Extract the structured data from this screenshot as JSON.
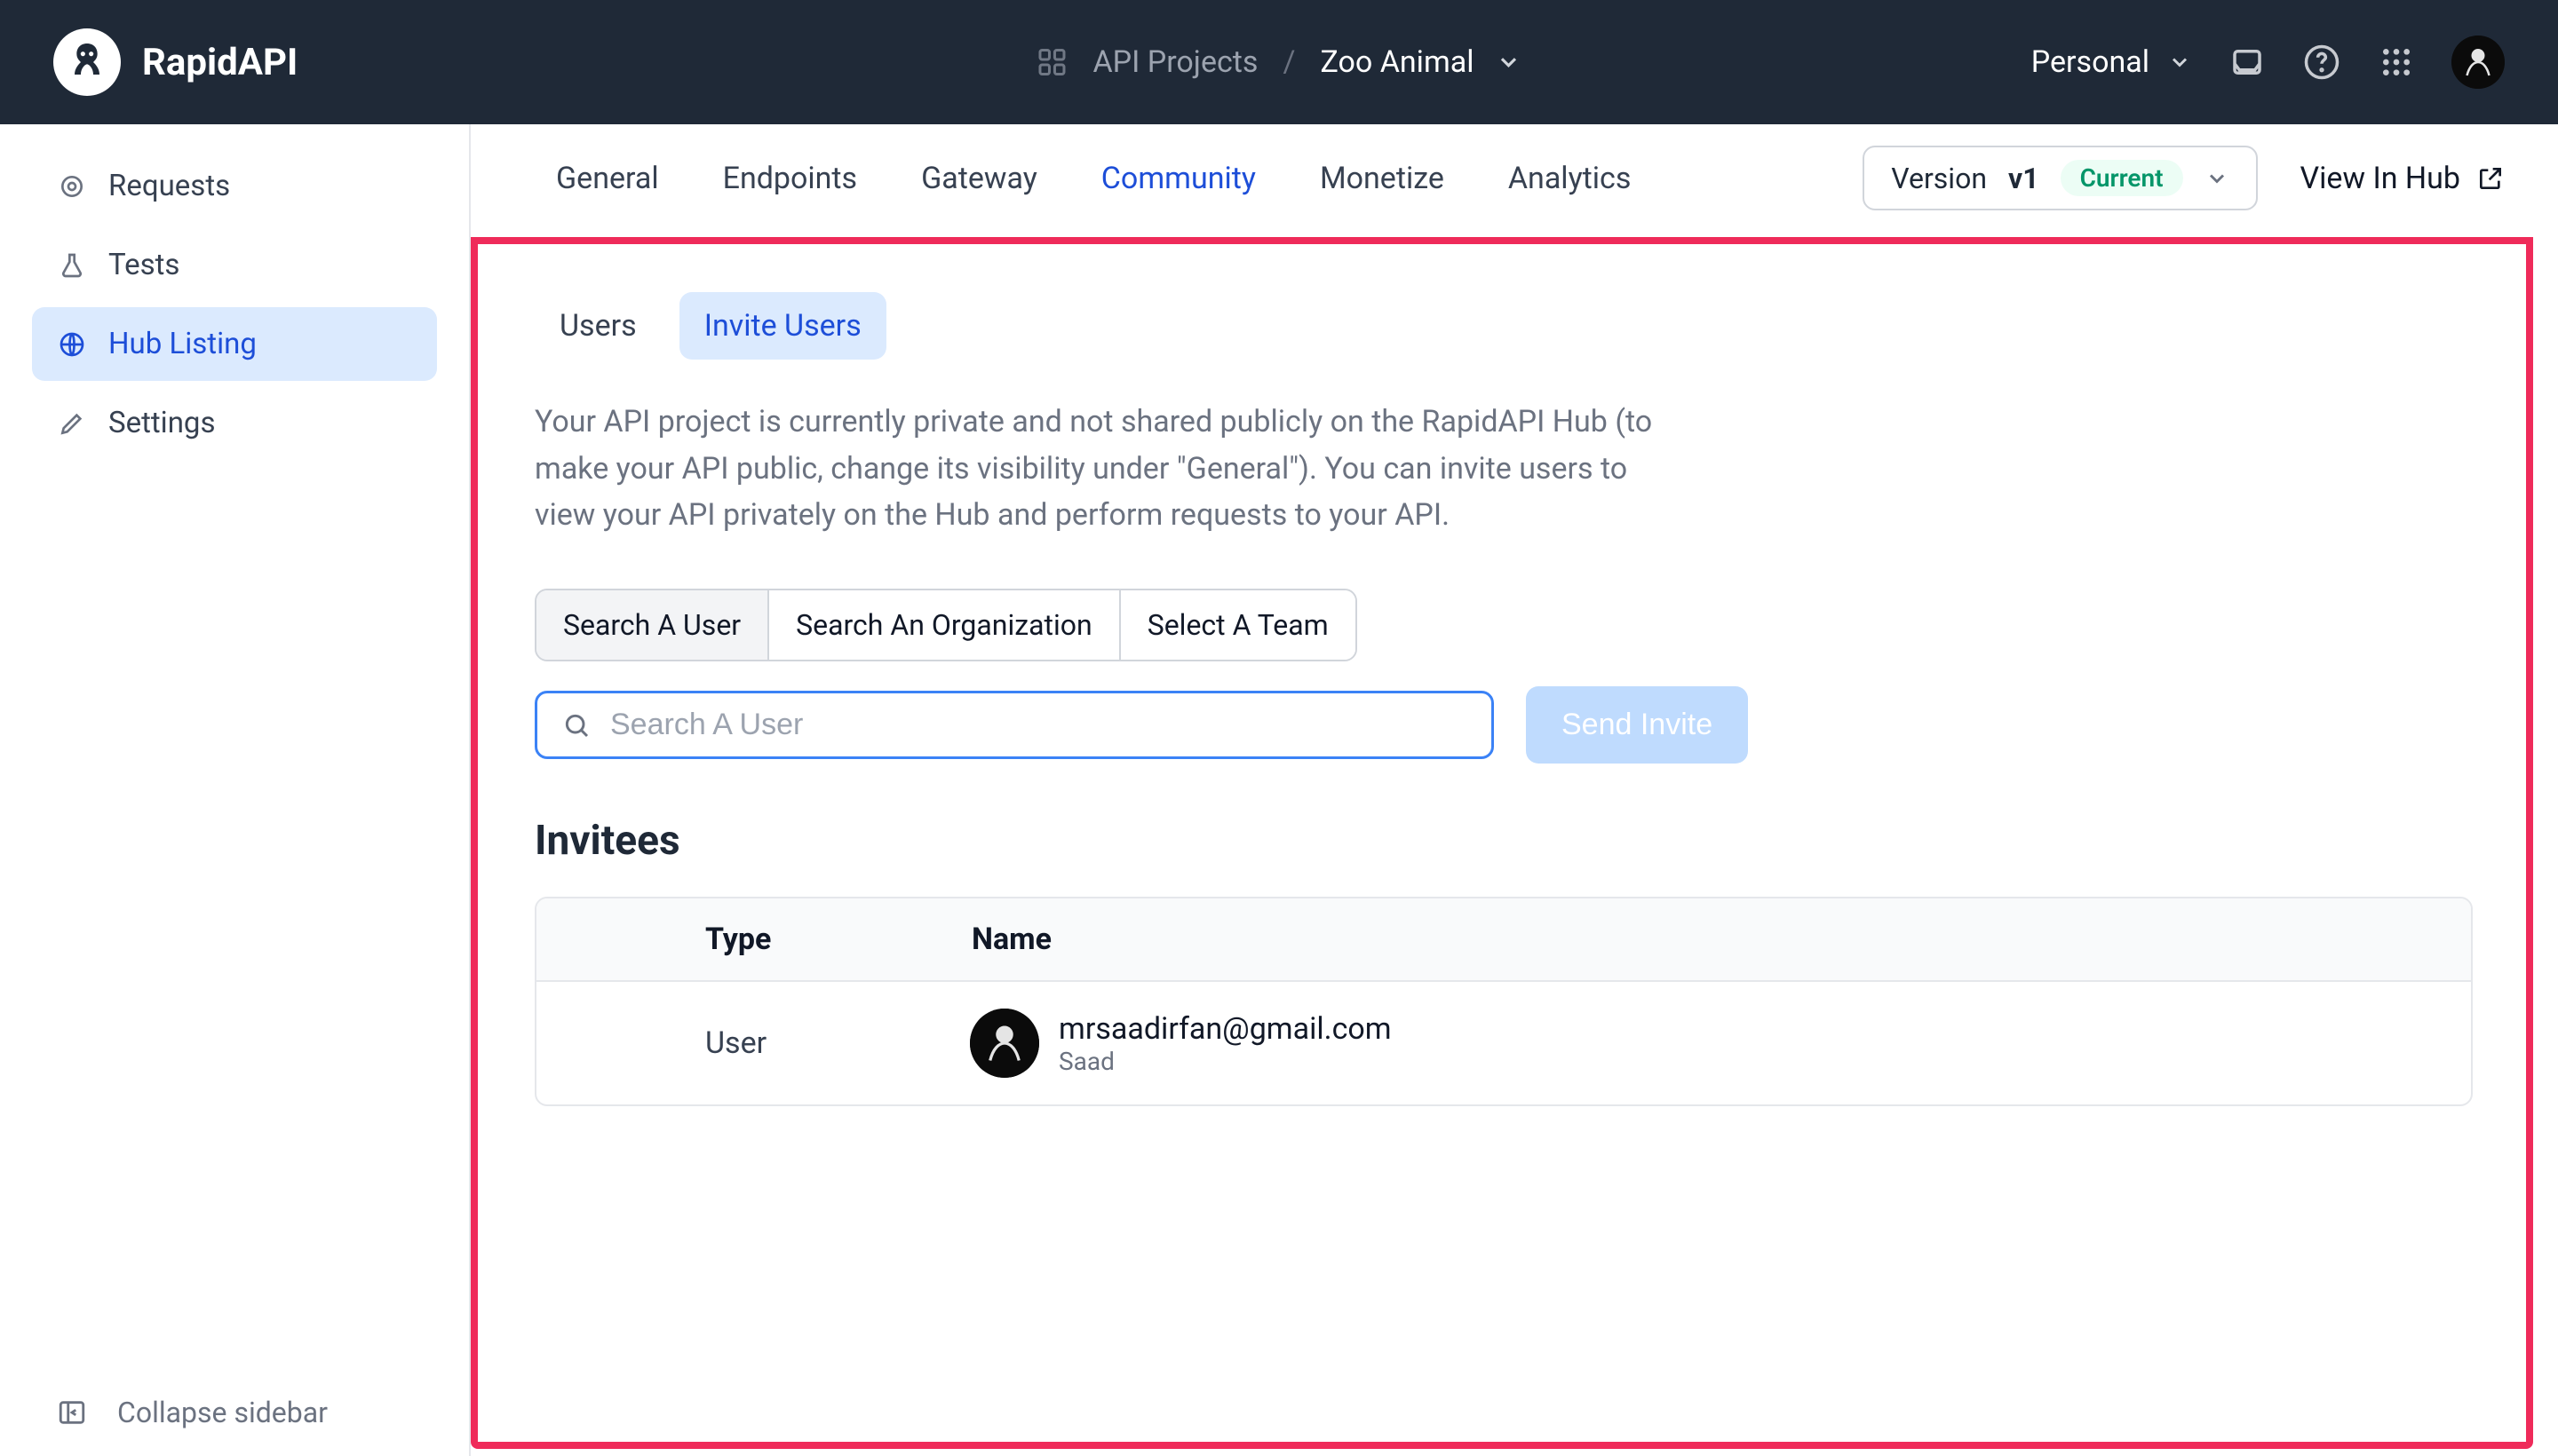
{
  "header": {
    "brand": "RapidAPI",
    "breadcrumb_root": "API Projects",
    "breadcrumb_sep": "/",
    "breadcrumb_current": "Zoo Animal",
    "workspace_label": "Personal"
  },
  "sidebar": {
    "items": [
      {
        "label": "Requests"
      },
      {
        "label": "Tests"
      },
      {
        "label": "Hub Listing"
      },
      {
        "label": "Settings"
      }
    ],
    "collapse_label": "Collapse sidebar"
  },
  "tabs": {
    "items": [
      {
        "label": "General"
      },
      {
        "label": "Endpoints"
      },
      {
        "label": "Gateway"
      },
      {
        "label": "Community"
      },
      {
        "label": "Monetize"
      },
      {
        "label": "Analytics"
      }
    ],
    "active_index": 3,
    "version_prefix": "Version",
    "version_value": "v1",
    "version_badge": "Current",
    "view_hub": "View In Hub"
  },
  "community": {
    "sub_tabs": [
      {
        "label": "Users"
      },
      {
        "label": "Invite Users"
      }
    ],
    "sub_active_index": 1,
    "desc": "Your API project is currently private and not shared publicly on the RapidAPI Hub (to make your API public, change its visibility under \"General\"). You can invite users to view your API privately on the Hub and perform requests to your API.",
    "seg_items": [
      {
        "label": "Search A User"
      },
      {
        "label": "Search An Organization"
      },
      {
        "label": "Select A Team"
      }
    ],
    "seg_active_index": 0,
    "search_placeholder": "Search A User",
    "send_invite_label": "Send Invite",
    "invitees_title": "Invitees",
    "table_headers": {
      "type": "Type",
      "name": "Name"
    },
    "invitees": [
      {
        "type": "User",
        "email": "mrsaadirfan@gmail.com",
        "name": "Saad"
      }
    ]
  },
  "colors": {
    "accent": "#1d4ed8",
    "highlight_border": "#ef2b5a"
  }
}
